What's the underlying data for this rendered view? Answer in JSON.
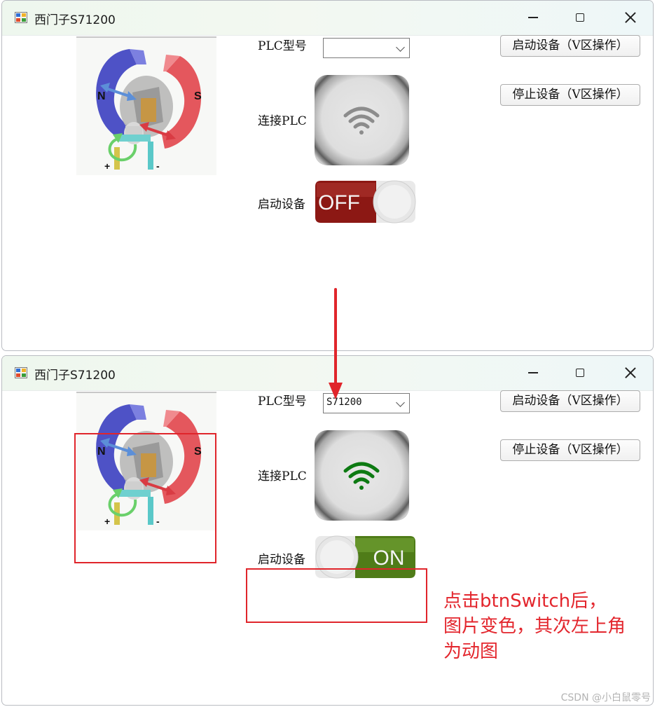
{
  "windows": [
    {
      "title": "西门子S71200",
      "plc_model_label": "PLC型号",
      "plc_model_value": "",
      "connect_label": "连接PLC",
      "wifi_color": "#8c8c8c",
      "start_device_label": "启动设备",
      "switch_text": "OFF",
      "switch_state": "off",
      "btn_start": "启动设备（V区操作）",
      "btn_stop": "停止设备（V区操作）",
      "motor": {
        "n": "N",
        "s": "S",
        "plus": "+",
        "minus": "-"
      }
    },
    {
      "title": "西门子S71200",
      "plc_model_label": "PLC型号",
      "plc_model_value": "S71200",
      "connect_label": "连接PLC",
      "wifi_color": "#0d7a12",
      "start_device_label": "启动设备",
      "switch_text": "ON",
      "switch_state": "on",
      "btn_start": "启动设备（V区操作）",
      "btn_stop": "停止设备（V区操作）",
      "motor": {
        "n": "N",
        "s": "S",
        "plus": "+",
        "minus": "-"
      }
    }
  ],
  "annotation": {
    "lines": [
      "点击btnSwitch后，",
      "图片变色，其次左上角",
      "为动图"
    ],
    "color": "#e3262d"
  },
  "watermark": "CSDN @小白鼠零号"
}
